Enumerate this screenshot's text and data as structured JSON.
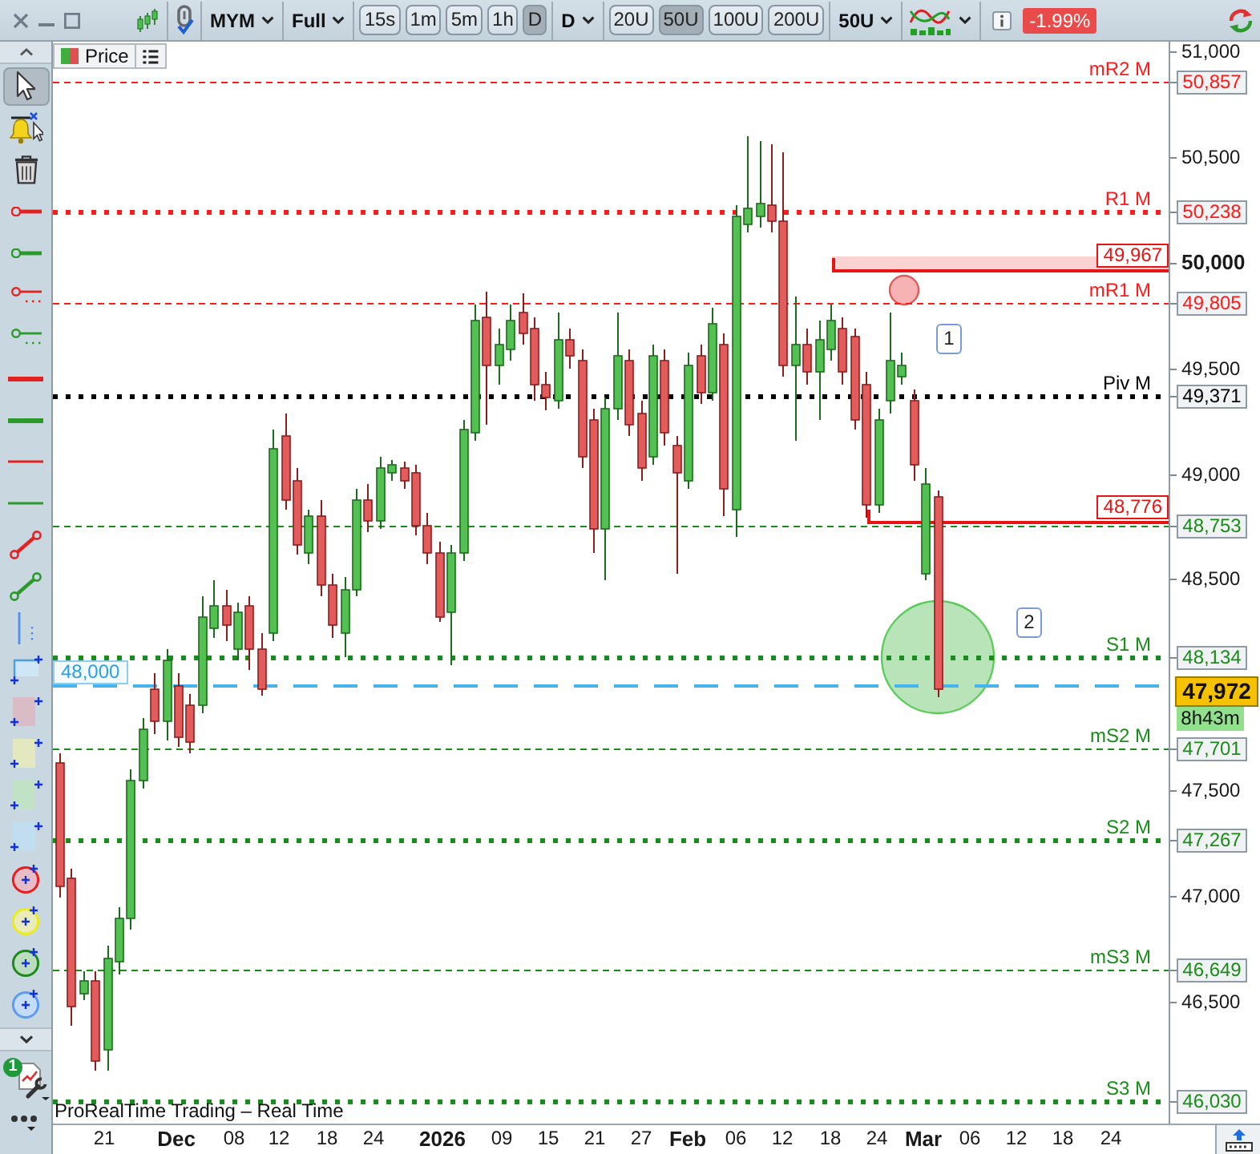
{
  "toolbar": {
    "instrument": "MYM",
    "view": "Full",
    "timeframes": [
      {
        "label": "15s",
        "selected": false
      },
      {
        "label": "1m",
        "selected": false
      },
      {
        "label": "5m",
        "selected": false
      },
      {
        "label": "1h",
        "selected": false
      },
      {
        "label": "D",
        "selected": true
      }
    ],
    "period": "D",
    "units": [
      {
        "label": "20U",
        "selected": false
      },
      {
        "label": "50U",
        "selected": true
      },
      {
        "label": "100U",
        "selected": false
      },
      {
        "label": "200U",
        "selected": false
      }
    ],
    "unit_size": "50U",
    "change": "-1.99%"
  },
  "tools": [
    {
      "selected": true
    },
    {
      "selected": false
    },
    {
      "selected": false
    },
    {
      "selected": false
    },
    {
      "selected": false
    },
    {
      "selected": false
    },
    {
      "selected": false
    },
    {
      "selected": false
    },
    {
      "selected": false
    },
    {
      "selected": false
    },
    {
      "selected": false
    },
    {
      "selected": false
    },
    {
      "selected": false
    },
    {
      "selected": false
    },
    {
      "selected": false
    },
    {
      "selected": false
    },
    {
      "selected": false
    },
    {
      "selected": false
    },
    {
      "selected": false
    },
    {
      "selected": false
    },
    {
      "selected": false
    },
    {
      "selected": false
    },
    {
      "selected": false
    }
  ],
  "tool_settings": {
    "badge": "1"
  },
  "chart": {
    "panel_title": "Price",
    "pivot_levels": [
      {
        "label": "mR2 M",
        "value": "50,857",
        "kind": "minor",
        "color": "#ff1a1a"
      },
      {
        "label": "R1 M",
        "value": "50,238",
        "kind": "major",
        "color": "#ff1a1a"
      },
      {
        "label": "mR1 M",
        "value": "49,805",
        "kind": "minor",
        "color": "#ff1a1a"
      },
      {
        "label": "Piv M",
        "value": "49,371",
        "kind": "major",
        "color": "#000000"
      },
      {
        "value": "48,753",
        "kind": "minor",
        "color": "#1a8c1a"
      },
      {
        "label": "S1 M",
        "value": "48,134",
        "kind": "major",
        "color": "#1a8c1a"
      },
      {
        "label": "mS2 M",
        "value": "47,701",
        "kind": "minor",
        "color": "#1a8c1a"
      },
      {
        "label": "S2 M",
        "value": "47,267",
        "kind": "major",
        "color": "#1a8c1a"
      },
      {
        "label": "mS3 M",
        "value": "46,649",
        "kind": "minor",
        "color": "#1a8c1a"
      },
      {
        "label": "S3 M",
        "value": "46,030",
        "kind": "major",
        "color": "#1a8c1a"
      }
    ],
    "drawn_levels": [
      {
        "kind": "zone",
        "value": "49,967"
      },
      {
        "kind": "line",
        "value": "48,776"
      }
    ],
    "price_line": {
      "value": "48,000"
    },
    "circles": [
      {
        "color": "#f7b3b3"
      },
      {
        "color": "#b9e3b9"
      }
    ],
    "notes": [
      {
        "text": "1"
      },
      {
        "text": "2"
      }
    ],
    "last_price": {
      "value": "47,972",
      "countdown": "8h43m"
    },
    "price_axis": [
      {
        "label": "51,000",
        "kind": "minor"
      },
      {
        "label": "50,500",
        "kind": "minor"
      },
      {
        "label": "50,000",
        "kind": "major"
      },
      {
        "label": "49,500",
        "kind": "minor"
      },
      {
        "label": "49,000",
        "kind": "minor"
      },
      {
        "label": "48,500",
        "kind": "minor"
      },
      {
        "label": "47,500",
        "kind": "minor"
      },
      {
        "label": "47,000",
        "kind": "minor"
      },
      {
        "label": "46,500",
        "kind": "minor"
      }
    ],
    "date_axis": [
      {
        "label": "21",
        "kind": "day"
      },
      {
        "label": "Dec",
        "kind": "period"
      },
      {
        "label": "08",
        "kind": "day"
      },
      {
        "label": "12",
        "kind": "day"
      },
      {
        "label": "18",
        "kind": "day"
      },
      {
        "label": "24",
        "kind": "day"
      },
      {
        "label": "2026",
        "kind": "period"
      },
      {
        "label": "09",
        "kind": "day"
      },
      {
        "label": "15",
        "kind": "day"
      },
      {
        "label": "21",
        "kind": "day"
      },
      {
        "label": "27",
        "kind": "day"
      },
      {
        "label": "Feb",
        "kind": "period"
      },
      {
        "label": "06",
        "kind": "day"
      },
      {
        "label": "12",
        "kind": "day"
      },
      {
        "label": "18",
        "kind": "day"
      },
      {
        "label": "24",
        "kind": "day"
      },
      {
        "label": "Mar",
        "kind": "period"
      },
      {
        "label": "06",
        "kind": "day"
      },
      {
        "label": "12",
        "kind": "day"
      },
      {
        "label": "18",
        "kind": "day"
      },
      {
        "label": "24",
        "kind": "day"
      }
    ],
    "source": "ProRealTime Trading – Real Time"
  }
}
